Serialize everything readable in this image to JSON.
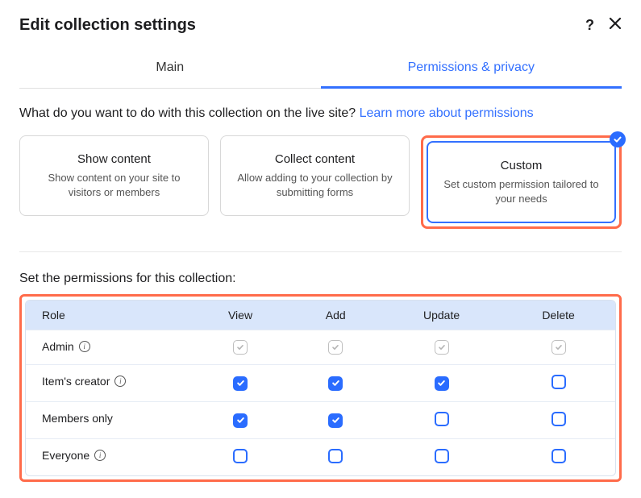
{
  "header": {
    "title": "Edit collection settings"
  },
  "tabs": {
    "main": "Main",
    "permissions": "Permissions & privacy"
  },
  "prompt": {
    "question": "What do you want to do with this collection on the live site? ",
    "link": "Learn more about permissions"
  },
  "cards": [
    {
      "title": "Show content",
      "desc": "Show content on your site to visitors or members",
      "selected": false
    },
    {
      "title": "Collect content",
      "desc": "Allow adding to your collection by submitting forms",
      "selected": false
    },
    {
      "title": "Custom",
      "desc": "Set custom permission tailored to your needs",
      "selected": true
    }
  ],
  "permissions": {
    "title": "Set the permissions for this collection:",
    "headers": {
      "role": "Role",
      "view": "View",
      "add": "Add",
      "update": "Update",
      "delete": "Delete"
    },
    "rows": [
      {
        "role": "Admin",
        "info": true,
        "view": "locked",
        "add": "locked",
        "update": "locked",
        "delete": "locked"
      },
      {
        "role": "Item's creator",
        "info": true,
        "view": "on",
        "add": "on",
        "update": "on",
        "delete": "off"
      },
      {
        "role": "Members only",
        "info": false,
        "view": "on",
        "add": "on",
        "update": "off",
        "delete": "off"
      },
      {
        "role": "Everyone",
        "info": true,
        "view": "off",
        "add": "off",
        "update": "off",
        "delete": "off"
      }
    ]
  }
}
